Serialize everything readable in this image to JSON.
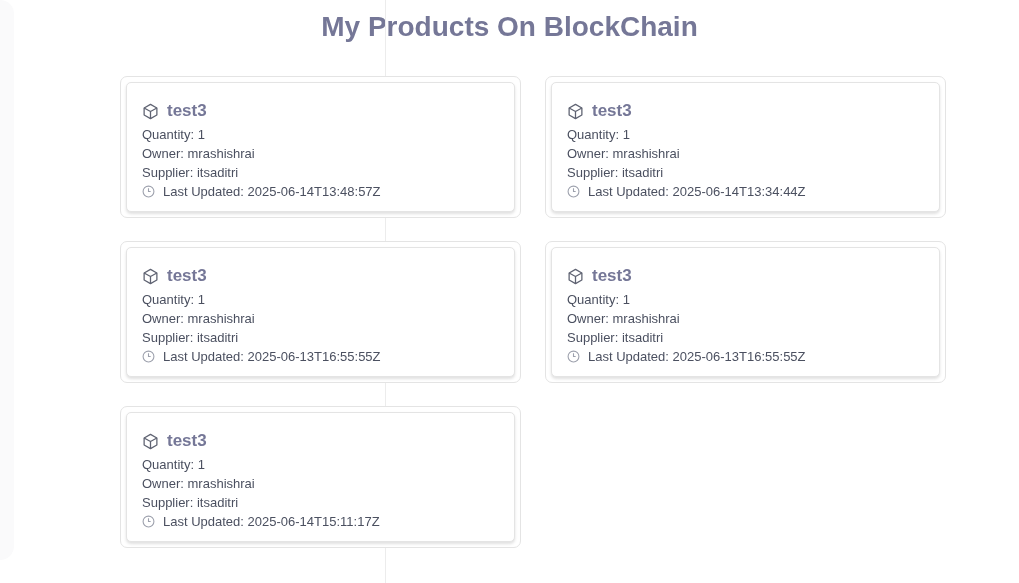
{
  "title": "My Products On BlockChain",
  "products": [
    {
      "name": "test3",
      "quantity": "Quantity: 1",
      "owner": "Owner: mrashishrai",
      "supplier": "Supplier: itsaditri",
      "updated": "Last Updated: 2025-06-14T13:48:57Z"
    },
    {
      "name": "test3",
      "quantity": "Quantity: 1",
      "owner": "Owner: mrashishrai",
      "supplier": "Supplier: itsaditri",
      "updated": "Last Updated: 2025-06-14T13:34:44Z"
    },
    {
      "name": "test3",
      "quantity": "Quantity: 1",
      "owner": "Owner: mrashishrai",
      "supplier": "Supplier: itsaditri",
      "updated": "Last Updated: 2025-06-13T16:55:55Z"
    },
    {
      "name": "test3",
      "quantity": "Quantity: 1",
      "owner": "Owner: mrashishrai",
      "supplier": "Supplier: itsaditri",
      "updated": "Last Updated: 2025-06-13T16:55:55Z"
    },
    {
      "name": "test3",
      "quantity": "Quantity: 1",
      "owner": "Owner: mrashishrai",
      "supplier": "Supplier: itsaditri",
      "updated": "Last Updated: 2025-06-14T15:11:17Z"
    }
  ]
}
